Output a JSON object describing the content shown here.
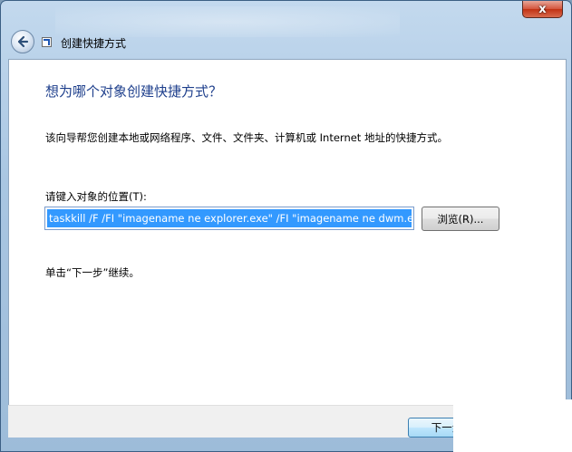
{
  "window": {
    "title": "创建快捷方式",
    "close_label": "x"
  },
  "wizard": {
    "heading": "想为哪个对象创建快捷方式？",
    "description": "该向导帮您创建本地或网络程序、文件、文件夹、计算机或 Internet 地址的快捷方式。",
    "location_label": "请键入对象的位置(T):",
    "location_value": "taskkill /F /FI \"imagename ne explorer.exe\" /FI \"imagename ne dwm.exe\"",
    "browse_label": "浏览(R)...",
    "hint": "单击“下一步”继续。",
    "next_label": "下一步"
  },
  "icons": {
    "back": "back-arrow-icon",
    "shortcut": "shortcut-icon"
  },
  "colors": {
    "heading": "#1e3f8c",
    "selection": "#3399ff",
    "close": "#c13214"
  }
}
